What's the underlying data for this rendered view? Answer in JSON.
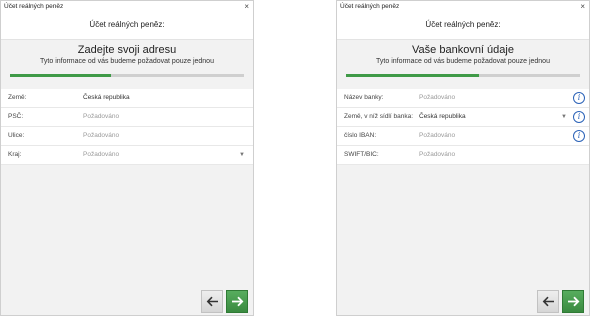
{
  "left_dialog": {
    "window_title": "Účet reálných peněz",
    "close_glyph": "×",
    "header": "Účet reálných peněz:",
    "step_title": "Zadejte svoji adresu",
    "step_subtitle": "Tyto informace od vás budeme požadovat pouze jednou",
    "progress": 0.43,
    "fields": [
      {
        "label": "Země:",
        "value": "Česká republika",
        "placeholder": false
      },
      {
        "label": "PSČ:",
        "value": "Požadováno",
        "placeholder": true
      },
      {
        "label": "Ulice:",
        "value": "Požadováno",
        "placeholder": true
      },
      {
        "label": "Kraj:",
        "value": "Požadováno",
        "placeholder": true
      }
    ],
    "dropdown_caret": "▼"
  },
  "right_dialog": {
    "window_title": "Účet reálných peněz",
    "close_glyph": "×",
    "header": "Účet reálných peněz:",
    "step_title": "Vaše bankovní údaje",
    "step_subtitle": "Tyto informace od vás budeme požadovat pouze jednou",
    "progress": 0.57,
    "fields": [
      {
        "label": "Název banky:",
        "value": "Požadováno",
        "placeholder": true
      },
      {
        "label": "Země, v níž sídlí banka:",
        "value": "Česká republika",
        "placeholder": false
      },
      {
        "label": "číslo IBAN:",
        "value": "Požadováno",
        "placeholder": true
      },
      {
        "label": "SWIFT/BIC:",
        "value": "Požadováno",
        "placeholder": true
      }
    ],
    "dropdown_caret": "▼",
    "info_glyph": "i"
  },
  "icons": {
    "back": "arrow-left-icon",
    "next": "arrow-right-icon"
  },
  "colors": {
    "accent_green": "#3f9a47",
    "info_blue": "#2c63b8",
    "progress_track": "#cfcfcf"
  }
}
